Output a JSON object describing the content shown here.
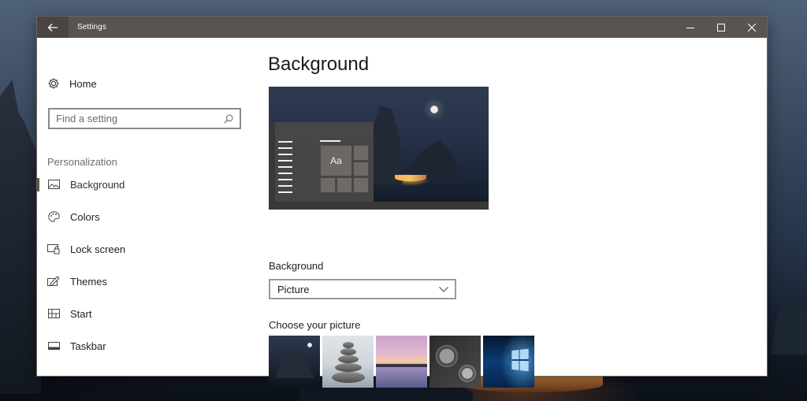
{
  "window": {
    "title": "Settings",
    "back_icon": "back-arrow-icon",
    "controls": [
      "minimize-icon",
      "maximize-icon",
      "close-icon"
    ]
  },
  "sidebar": {
    "home_label": "Home",
    "search_placeholder": "Find a setting",
    "section_label": "Personalization",
    "items": [
      {
        "label": "Background",
        "icon": "picture-icon",
        "selected": true
      },
      {
        "label": "Colors",
        "icon": "palette-icon",
        "selected": false
      },
      {
        "label": "Lock screen",
        "icon": "lock-screen-icon",
        "selected": false
      },
      {
        "label": "Themes",
        "icon": "themes-icon",
        "selected": false
      },
      {
        "label": "Start",
        "icon": "start-icon",
        "selected": false
      },
      {
        "label": "Taskbar",
        "icon": "taskbar-icon",
        "selected": false
      }
    ]
  },
  "main": {
    "title": "Background",
    "preview_tile_text": "Aa",
    "background_label": "Background",
    "background_value": "Picture",
    "choose_label": "Choose your picture",
    "pictures": [
      "night-lake-picture",
      "stacked-stones-picture",
      "pink-sunset-lake-picture",
      "gears-picture",
      "windows-logo-picture"
    ]
  },
  "colors": {
    "titlebar": "#5a5450",
    "accent": "#5a5450",
    "window_bg": "#ffffff"
  }
}
